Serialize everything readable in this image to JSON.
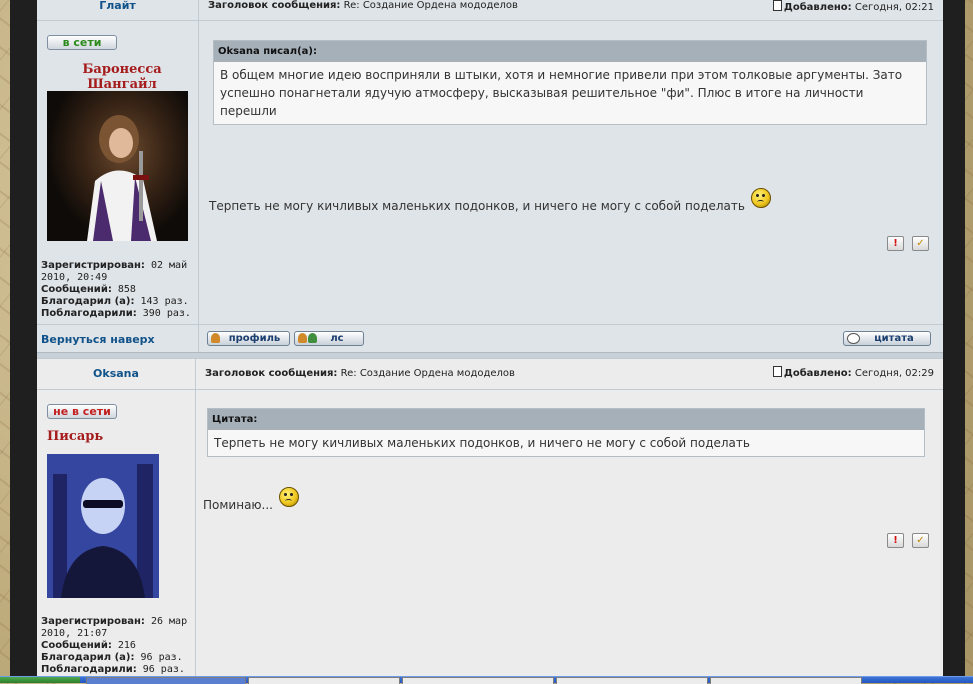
{
  "post1": {
    "author": "Глайт",
    "subject_label": "Заголовок сообщения:",
    "subject": "Re: Создание Ордена мододелов",
    "date_label": "Добавлено:",
    "date": "Сегодня, 02:21",
    "status": "в сети",
    "rank": "Баронесса Шангайл",
    "info": {
      "registered_label": "Зарегистрирован:",
      "registered": "02 май 2010, 20:49",
      "posts_label": "Сообщений:",
      "posts": "858",
      "thanked_label": "Благодарил (а):",
      "thanked": "143 раз.",
      "was_thanked_label": "Поблагодарили:",
      "was_thanked": "390 раз."
    },
    "quote_head": "Oksana писал(а):",
    "quote_body": "В общем многие идею восприняли в штыки, хотя и немногие привели при этом толковые аргументы. Зато успешно понагнетали ядучую атмосферу, высказывая решительное \"фи\". Плюс в итоге на личности перешли",
    "message": "Терпеть не могу кичливых маленьких подонков, и ничего не могу с собой поделать",
    "back_to_top": "Вернуться наверх",
    "profile_btn": "профиль",
    "pm_btn": "лс",
    "quote_btn": "цитата"
  },
  "post2": {
    "author": "Oksana",
    "subject_label": "Заголовок сообщения:",
    "subject": "Re: Создание Ордена мододелов",
    "date_label": "Добавлено:",
    "date": "Сегодня, 02:29",
    "status": "не в сети",
    "rank": "Писарь",
    "info": {
      "registered_label": "Зарегистрирован:",
      "registered": "26 мар 2010, 21:07",
      "posts_label": "Сообщений:",
      "posts": "216",
      "thanked_label": "Благодарил (а):",
      "thanked": "96 раз.",
      "was_thanked_label": "Поблагодарили:",
      "was_thanked": "96 раз."
    },
    "quote_head": "Цитата:",
    "quote_body": "Терпеть не могу кичливых маленьких подонков, и ничего не могу с собой поделать",
    "message": "Поминаю..."
  },
  "icons": {
    "warn": "!",
    "thumb": "👍"
  },
  "colors": {
    "link": "#105289",
    "online": "#2a8a1a",
    "offline": "#c21f1f",
    "rank": "#a51c1c",
    "quote_header": "#a6b0b9"
  }
}
